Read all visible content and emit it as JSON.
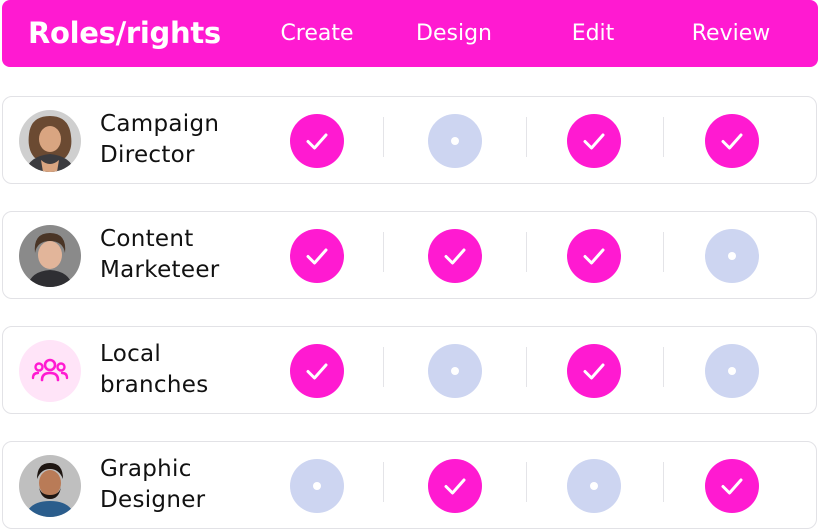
{
  "header": {
    "title": "Roles/rights",
    "columns": [
      "Create",
      "Design",
      "Edit",
      "Review"
    ]
  },
  "colors": {
    "accent": "#ff1ad1",
    "inactive": "#cdd5f1",
    "border": "#e2e2e6"
  },
  "rows": [
    {
      "name_line1": "Campaign",
      "name_line2": "Director",
      "avatar": "woman-portrait",
      "rights": [
        true,
        false,
        true,
        true
      ]
    },
    {
      "name_line1": "Content",
      "name_line2": "Marketeer",
      "avatar": "man-portrait",
      "rights": [
        true,
        true,
        true,
        false
      ]
    },
    {
      "name_line1": "Local",
      "name_line2": "branches",
      "avatar": "group-icon",
      "rights": [
        true,
        false,
        true,
        false
      ]
    },
    {
      "name_line1": "Graphic",
      "name_line2": "Designer",
      "avatar": "bearded-man-portrait",
      "rights": [
        false,
        true,
        false,
        true
      ]
    }
  ]
}
